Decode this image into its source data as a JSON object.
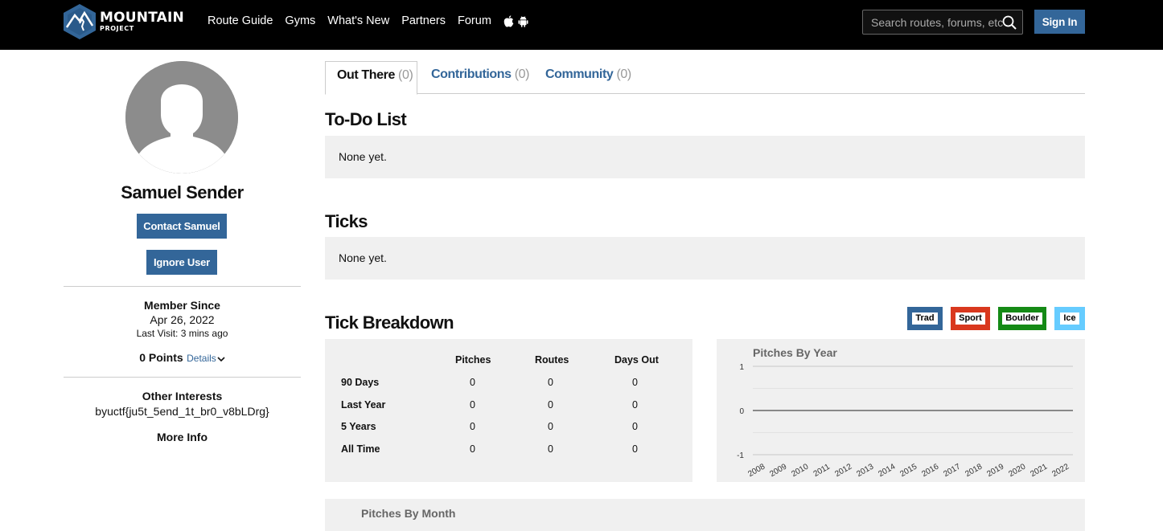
{
  "header": {
    "logo_main": "MOUNTAIN",
    "logo_sub": "PROJECT",
    "nav_items": [
      "Route Guide",
      "Gyms",
      "What's New",
      "Partners",
      "Forum"
    ],
    "search_placeholder": "Search routes, forums, etc",
    "sign_in_label": "Sign In"
  },
  "profile": {
    "name": "Samuel Sender",
    "contact_label": "Contact Samuel",
    "ignore_label": "Ignore User",
    "member_since_label": "Member Since",
    "member_since_date": "Apr 26, 2022",
    "last_visit": "Last Visit: 3 mins ago",
    "points": "0 Points",
    "details_label": "Details",
    "other_interests_label": "Other Interests",
    "other_interests_value": "byuctf{ju5t_5end_1t_br0_v8bLDrg}",
    "more_info_label": "More Info"
  },
  "tabs": [
    {
      "label": "Out There",
      "count": "(0)"
    },
    {
      "label": "Contributions",
      "count": "(0)"
    },
    {
      "label": "Community",
      "count": "(0)"
    }
  ],
  "todo": {
    "heading": "To-Do List",
    "empty_text": "None yet."
  },
  "ticks": {
    "heading": "Ticks",
    "empty_text": "None yet."
  },
  "tick_breakdown": {
    "heading": "Tick Breakdown",
    "legend": [
      "Trad",
      "Sport",
      "Boulder",
      "Ice"
    ],
    "colors": {
      "Trad": "#336699",
      "Sport": "#d9381e",
      "Boulder": "#158a16",
      "Ice": "#66ccff"
    },
    "table": {
      "columns": [
        "Pitches",
        "Routes",
        "Days Out"
      ],
      "rows": [
        {
          "label": "90 Days",
          "values": [
            "0",
            "0",
            "0"
          ]
        },
        {
          "label": "Last Year",
          "values": [
            "0",
            "0",
            "0"
          ]
        },
        {
          "label": "5 Years",
          "values": [
            "0",
            "0",
            "0"
          ]
        },
        {
          "label": "All Time",
          "values": [
            "0",
            "0",
            "0"
          ]
        }
      ]
    }
  },
  "chart_data": {
    "type": "line",
    "title": "Pitches By Year",
    "xlabel": "",
    "ylabel": "",
    "x": [
      "2008",
      "2009",
      "2010",
      "2011",
      "2012",
      "2013",
      "2014",
      "2015",
      "2016",
      "2017",
      "2018",
      "2019",
      "2020",
      "2021",
      "2022"
    ],
    "series": [
      {
        "values": [
          0,
          0,
          0,
          0,
          0,
          0,
          0,
          0,
          0,
          0,
          0,
          0,
          0,
          0,
          0
        ]
      }
    ],
    "y_ticks": [
      "1",
      "0",
      "-1"
    ],
    "ylim": [
      -1,
      1
    ],
    "grid": true
  },
  "pitches_by_month": {
    "title": "Pitches By Month"
  }
}
